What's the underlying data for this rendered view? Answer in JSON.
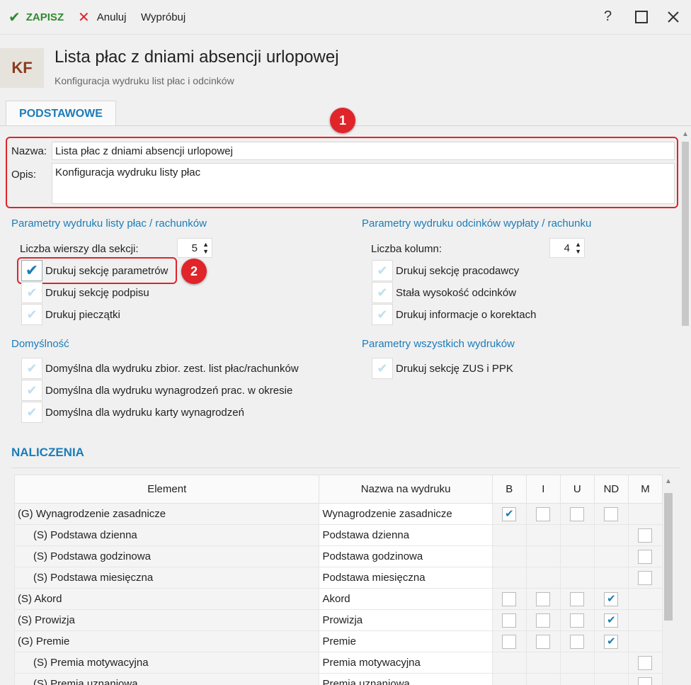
{
  "toolbar": {
    "save_label": "ZAPISZ",
    "cancel_label": "Anuluj",
    "try_label": "Wypróbuj",
    "help_label": "?"
  },
  "header": {
    "badge": "KF",
    "title": "Lista płac z dniami absencji urlopowej",
    "subtitle": "Konfiguracja wydruku list płac i odcinków"
  },
  "tab": {
    "label": "PODSTAWOWE"
  },
  "badges": {
    "one": "1",
    "two": "2"
  },
  "form": {
    "name_label": "Nazwa:",
    "name_value": "Lista płac z dniami absencji urlopowej",
    "desc_label": "Opis:",
    "desc_value": "Konfiguracja wydruku listy płac"
  },
  "left_section": {
    "title": "Parametry wydruku listy płac / rachunków",
    "rows_label": "Liczba wierszy dla sekcji:",
    "rows_value": "5",
    "checkboxes": [
      {
        "label": "Drukuj sekcję parametrów",
        "checked": true
      },
      {
        "label": "Drukuj sekcję podpisu",
        "checked": false
      },
      {
        "label": "Drukuj pieczątki",
        "checked": false
      }
    ]
  },
  "right_section": {
    "title": "Parametry wydruku odcinków wypłaty / rachunku",
    "cols_label": "Liczba kolumn:",
    "cols_value": "4",
    "checkboxes": [
      {
        "label": "Drukuj sekcję pracodawcy",
        "checked": false
      },
      {
        "label": "Stała wysokość odcinków",
        "checked": false
      },
      {
        "label": "Drukuj informacje o korektach",
        "checked": false
      }
    ]
  },
  "default_section": {
    "title": "Domyślność",
    "checkboxes": [
      {
        "label": "Domyślna dla wydruku zbior. zest. list płac/rachunków",
        "checked": false
      },
      {
        "label": "Domyślna dla wydruku wynagrodzeń prac. w okresie",
        "checked": false
      },
      {
        "label": "Domyślna dla wydruku karty wynagrodzeń",
        "checked": false
      }
    ]
  },
  "all_section": {
    "title": "Parametry wszystkich wydruków",
    "checkboxes": [
      {
        "label": "Drukuj sekcję ZUS i PPK",
        "checked": false
      }
    ]
  },
  "naliczenia": {
    "title": "NALICZENIA",
    "columns": [
      "Element",
      "Nazwa na wydruku",
      "B",
      "I",
      "U",
      "ND",
      "M"
    ],
    "rows": [
      {
        "element": "(G) Wynagrodzenie zasadnicze",
        "name": "Wynagrodzenie zasadnicze",
        "sub": false,
        "B": "on",
        "I": "off",
        "U": "off",
        "ND": "off",
        "M": "none"
      },
      {
        "element": "(S) Podstawa dzienna",
        "name": "Podstawa dzienna",
        "sub": true,
        "B": "none",
        "I": "none",
        "U": "none",
        "ND": "none",
        "M": "off"
      },
      {
        "element": "(S) Podstawa godzinowa",
        "name": "Podstawa godzinowa",
        "sub": true,
        "B": "none",
        "I": "none",
        "U": "none",
        "ND": "none",
        "M": "off"
      },
      {
        "element": "(S) Podstawa miesięczna",
        "name": "Podstawa miesięczna",
        "sub": true,
        "B": "none",
        "I": "none",
        "U": "none",
        "ND": "none",
        "M": "off"
      },
      {
        "element": "(S) Akord",
        "name": "Akord",
        "sub": false,
        "B": "off",
        "I": "off",
        "U": "off",
        "ND": "on",
        "M": "none"
      },
      {
        "element": "(S) Prowizja",
        "name": "Prowizja",
        "sub": false,
        "B": "off",
        "I": "off",
        "U": "off",
        "ND": "on",
        "M": "none"
      },
      {
        "element": "(G) Premie",
        "name": "Premie",
        "sub": false,
        "B": "off",
        "I": "off",
        "U": "off",
        "ND": "on",
        "M": "none"
      },
      {
        "element": "(S) Premia motywacyjna",
        "name": "Premia motywacyjna",
        "sub": true,
        "B": "none",
        "I": "none",
        "U": "none",
        "ND": "none",
        "M": "off"
      },
      {
        "element": "(S) Premia uznaniowa",
        "name": "Premia uznaniowa",
        "sub": true,
        "B": "none",
        "I": "none",
        "U": "none",
        "ND": "none",
        "M": "off"
      }
    ]
  },
  "colors": {
    "accent": "#1c7cb8",
    "save_green": "#2e8b2e",
    "highlight_red": "#e0242a"
  }
}
